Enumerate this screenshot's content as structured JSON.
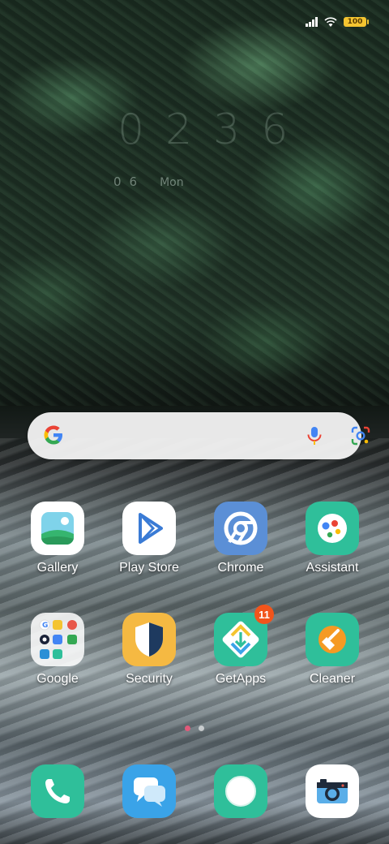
{
  "status_bar": {
    "battery_level": "100",
    "icons": [
      "signal-icon",
      "wifi-icon",
      "battery-icon"
    ]
  },
  "clock": {
    "time": "0236",
    "date": "06",
    "day": "Mon"
  },
  "search_bar": {
    "icons": [
      "google-g-icon",
      "microphone-icon",
      "google-lens-icon"
    ]
  },
  "apps": [
    {
      "label": "Gallery",
      "icon": "gallery-icon",
      "color": "#ffffff"
    },
    {
      "label": "Play Store",
      "icon": "play-store-icon",
      "color": "#ffffff"
    },
    {
      "label": "Chrome",
      "icon": "chrome-icon",
      "color": "#5b8fd6"
    },
    {
      "label": "Assistant",
      "icon": "assistant-icon",
      "color": "#2fbf9a"
    },
    {
      "label": "Google",
      "icon": "folder-icon",
      "color": "#ffffff"
    },
    {
      "label": "Security",
      "icon": "shield-icon",
      "color": "#f5b942"
    },
    {
      "label": "GetApps",
      "icon": "getapps-icon",
      "color": "#2fbf9a",
      "badge": "11"
    },
    {
      "label": "Cleaner",
      "icon": "broom-icon",
      "color": "#2fbf9a"
    }
  ],
  "page_indicator": {
    "pages": 2,
    "active": 1,
    "active_color": "#e05a7a"
  },
  "dock": [
    {
      "icon": "phone-icon",
      "color": "#2fbf9a"
    },
    {
      "icon": "messages-icon",
      "color": "#3aa3e8"
    },
    {
      "icon": "browser-icon",
      "color": "#2fbf9a"
    },
    {
      "icon": "camera-icon",
      "color": "#ffffff"
    }
  ]
}
